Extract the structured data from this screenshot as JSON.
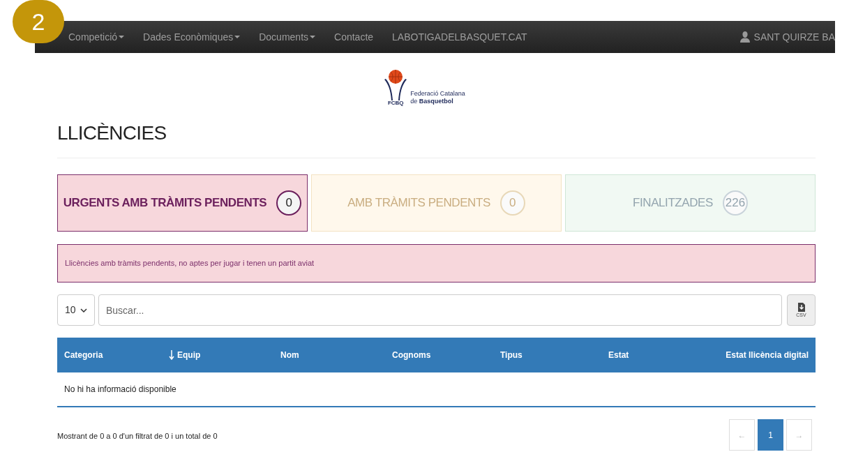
{
  "step_badge": "2",
  "navbar": {
    "items": [
      {
        "label": "Competició",
        "dropdown": true
      },
      {
        "label": "Dades Econòmiques",
        "dropdown": true
      },
      {
        "label": "Documents",
        "dropdown": true
      },
      {
        "label": "Contacte",
        "dropdown": false
      },
      {
        "label": "LABOTIGADELBASQUET.CAT",
        "dropdown": false
      }
    ],
    "user": "SANT QUIRZE BA"
  },
  "logo": {
    "mark": "FCBQ",
    "line1": "Federació Catalana",
    "line2": "de **Basquetbol**"
  },
  "title": "LLICÈNCIES",
  "tabs": [
    {
      "kind": "urgent",
      "label": "URGENTS AMB TRÀMITS PENDENTS",
      "count": "0",
      "selected": true
    },
    {
      "kind": "pending",
      "label": "AMB TRÀMITS PENDENTS",
      "count": "0",
      "selected": false
    },
    {
      "kind": "done",
      "label": "FINALITZADES",
      "count": "226",
      "selected": false
    }
  ],
  "alert": "Llicències amb tràmits pendents, no aptes per jugar i tenen un partit aviat",
  "page_size": "10",
  "search": {
    "placeholder": "Buscar..."
  },
  "export_button": "CSV",
  "table": {
    "columns": [
      {
        "label": "Categoria",
        "sorted": false
      },
      {
        "label": "Equip",
        "sorted": true
      },
      {
        "label": "Nom",
        "sorted": false
      },
      {
        "label": "Cognoms",
        "sorted": false
      },
      {
        "label": "Tipus",
        "sorted": false
      },
      {
        "label": "Estat",
        "sorted": false
      },
      {
        "label": "Estat llicència digital",
        "sorted": false
      }
    ],
    "empty": "No hi ha informació disponible"
  },
  "summary": "Mostrant de 0 a 0 d'un filtrat de 0 i un total de 0",
  "pagination": [
    {
      "label": "←",
      "selected": false,
      "disabled": true
    },
    {
      "label": "1",
      "selected": true,
      "disabled": false
    },
    {
      "label": "→",
      "selected": false,
      "disabled": true
    }
  ]
}
